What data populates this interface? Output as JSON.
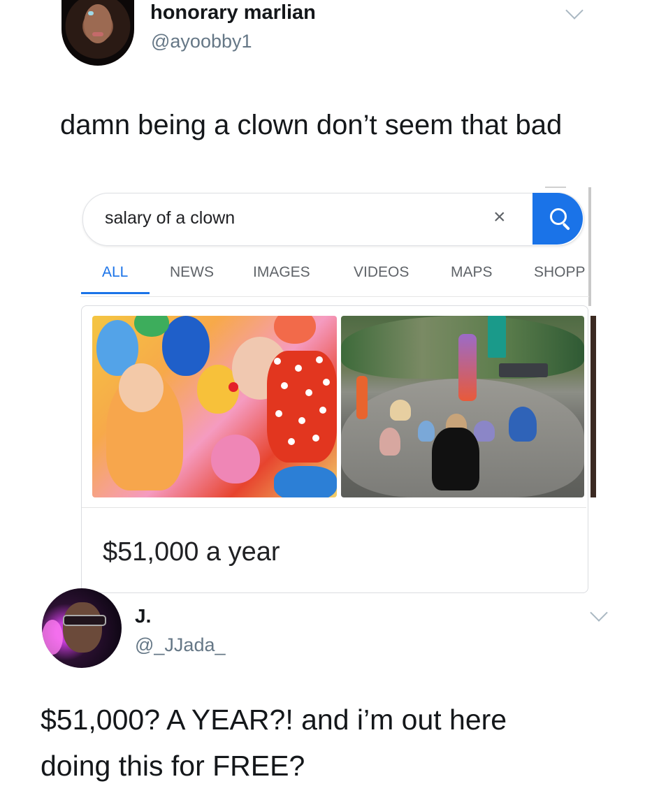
{
  "tweet1": {
    "display_name": "honorary marlian",
    "handle": "@ayoobby1",
    "text": "damn being a clown don’t seem that bad",
    "avatar": "profile-photo"
  },
  "google": {
    "query": "salary of a clown",
    "clear_icon": "×",
    "search_icon": "search-icon",
    "tabs": [
      {
        "label": "ALL",
        "active": true
      },
      {
        "label": "NEWS"
      },
      {
        "label": "IMAGES"
      },
      {
        "label": "VIDEOS"
      },
      {
        "label": "MAPS"
      },
      {
        "label": "SHOPP"
      }
    ],
    "images": [
      {
        "subject": "clown-with-child-and-balloons"
      },
      {
        "subject": "clown-performing-for-seated-children-in-park"
      }
    ],
    "answer": "$51,000 a year",
    "accent_color": "#1a73e8"
  },
  "tweet2": {
    "display_name": "J.",
    "handle": "@_JJada_",
    "text_line1": "$51,000? A YEAR?! and i’m out here",
    "text_line2": "doing this for FREE?",
    "avatar": "profile-photo"
  },
  "colors": {
    "text": "#14171a",
    "secondary": "#657786"
  }
}
